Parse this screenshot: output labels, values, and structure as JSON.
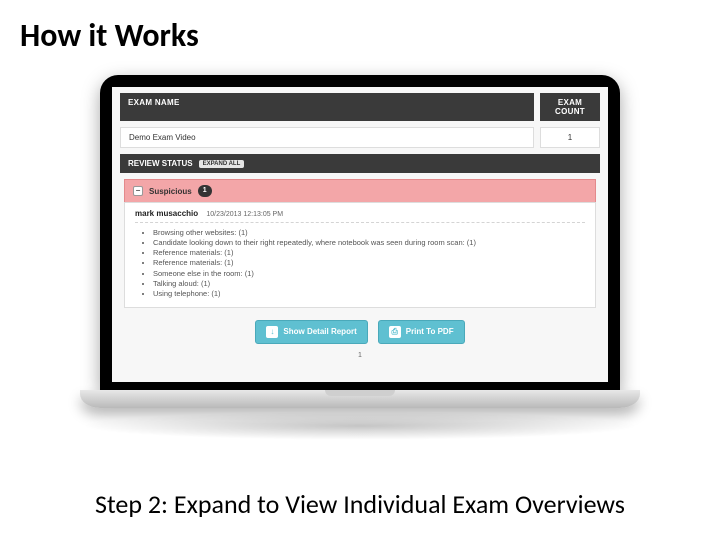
{
  "slide": {
    "title": "How it Works",
    "caption": "Step 2: Expand to View Individual Exam Overviews"
  },
  "header": {
    "exam_name_label": "EXAM NAME",
    "exam_count_label": "EXAM COUNT",
    "exam_name_value": "Demo Exam Video",
    "exam_count_value": "1",
    "review_status_label": "REVIEW STATUS",
    "expand_all_label": "EXPAND ALL"
  },
  "alert": {
    "status_label": "Suspicious",
    "status_count": "1",
    "student_name": "mark musacchio",
    "timestamp": "10/23/2013 12:13:05 PM",
    "items": [
      "Browsing other websites: (1)",
      "Candidate looking down to their right repeatedly, where notebook was seen during room scan: (1)",
      "Reference materials: (1)",
      "Reference materials: (1)",
      "Someone else in the room: (1)",
      "Talking aloud: (1)",
      "Using telephone: (1)"
    ]
  },
  "buttons": {
    "detail_report": "Show Detail Report",
    "print_pdf": "Print To PDF"
  },
  "pager": "1"
}
